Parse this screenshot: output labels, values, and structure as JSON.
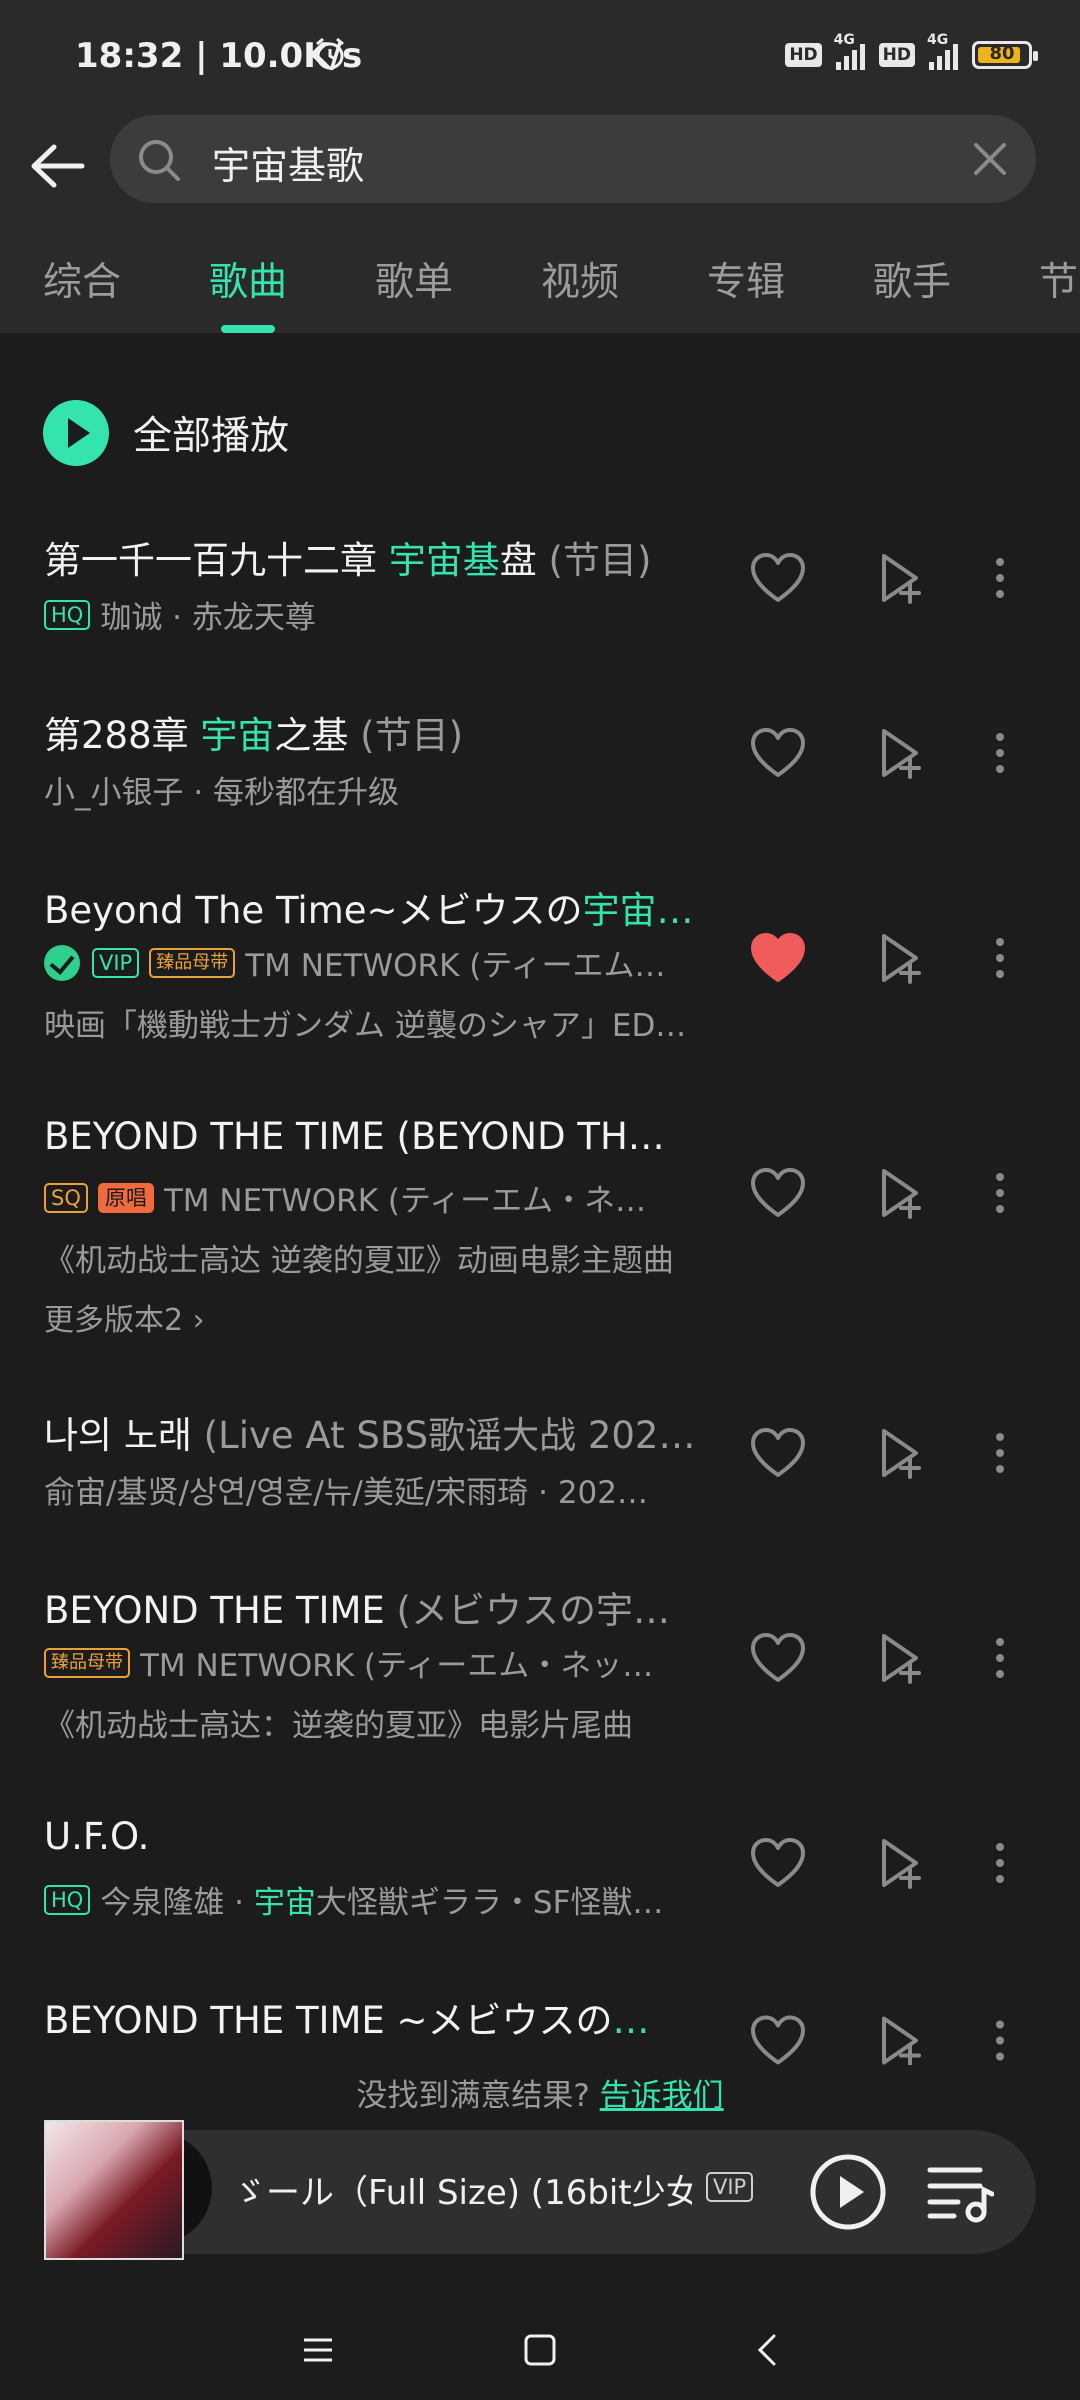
{
  "status_bar": {
    "time": "18:32 | 10.0K/s",
    "hd1": "HD",
    "net1": "4G",
    "hd2": "HD",
    "net2": "4G",
    "battery": "80"
  },
  "search": {
    "value": "宇宙基歌"
  },
  "tabs": [
    "综合",
    "歌曲",
    "歌单",
    "视频",
    "专辑",
    "歌手",
    "节"
  ],
  "play_all_label": "全部播放",
  "songs": [
    {
      "title_a": "第一千一百九十二章 ",
      "title_hl": "宇宙基",
      "title_b": "盘",
      "title_dim": " (节目)",
      "badge": "HQ",
      "sub": "珈诚 · 赤龙天尊"
    },
    {
      "title_a": "第288章 ",
      "title_hl": "宇宙",
      "title_b": "之基",
      "title_dim": " (节目)",
      "sub": "小_小银子 · 每秒都在升级"
    },
    {
      "title_a": "Beyond The Time~メビウスの",
      "title_hl": "宇宙…",
      "badge1": "VIP",
      "badge2": "臻品母带",
      "sub": "TM NETWORK (ティーエム…",
      "desc": "映画「機動戦士ガンダム 逆襲のシャア」ED…",
      "liked": true
    },
    {
      "title_a": "BEYOND THE TIME (BEYOND TH…",
      "badge1": "SQ",
      "badge2": "原唱",
      "sub": "TM NETWORK (ティーエム・ネ…",
      "desc": "《机动战士高达 逆袭的夏亚》动画电影主题曲",
      "more": "更多版本2 ›"
    },
    {
      "title_a": "나의 노래",
      "title_dim": " (Live At SBS歌谣大战 202…",
      "sub": "俞宙/基贤/상연/영훈/뉴/美延/宋雨琦 · 202…"
    },
    {
      "title_a": "BEYOND THE TIME",
      "title_dim": " (メビウスの宇…",
      "badge": "臻品母带",
      "sub": "TM NETWORK (ティーエム・ネッ…",
      "desc": "《机动战士高达：逆袭的夏亚》电影片尾曲"
    },
    {
      "title_a": "U.F.O.",
      "badge": "HQ",
      "sub_a": "今泉隆雄 · ",
      "sub_hl": "宇宙",
      "sub_b": "大怪獣ギララ・SF怪獣…"
    },
    {
      "title_a": "BEYOND THE TIME ~メビウスの",
      "title_hl": "…"
    }
  ],
  "feedback": {
    "text": "没找到满意结果? ",
    "link": "告诉我们"
  },
  "player": {
    "title": "ゞール（Full Size) (16bit少女)",
    "badge": "VIP"
  },
  "icons": [
    "back-arrow-icon",
    "search-icon",
    "clear-icon",
    "heart-icon",
    "add-to-queue-icon",
    "more-icon",
    "play-icon",
    "playlist-icon",
    "menu-icon",
    "home-icon",
    "back-icon"
  ],
  "colors": {
    "accent": "#34e3ad",
    "background": "#1c1c1c",
    "header": "#2a2a2a",
    "liked": "#f05c5c",
    "gold": "#e9a23b",
    "orange": "#ef6a3c"
  }
}
